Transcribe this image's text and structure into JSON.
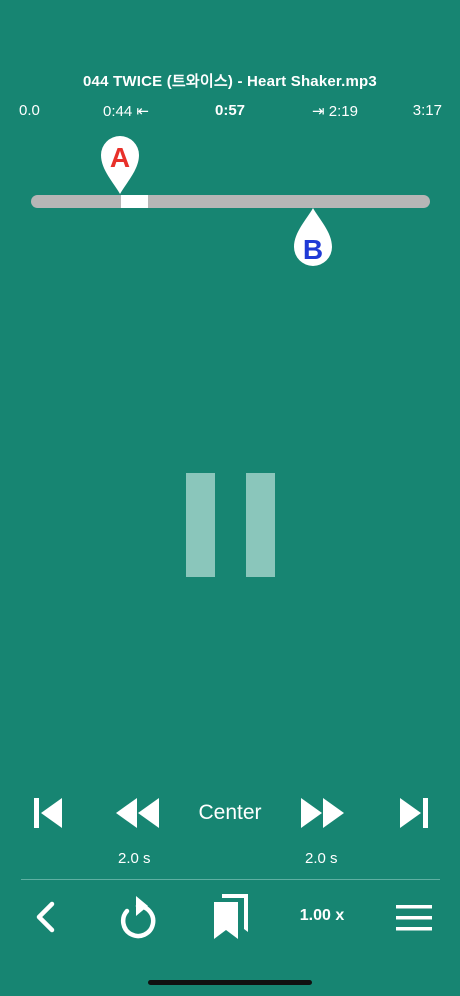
{
  "track": {
    "title": "044 TWICE (트와이스) - Heart Shaker.mp3"
  },
  "times": {
    "start": "0.0",
    "a_point": "0:44 ⇤",
    "current": "0:57",
    "b_point": "⇥ 2:19",
    "end": "3:17"
  },
  "markers": {
    "a_label": "A",
    "b_label": "B",
    "a_color": "#e8302a",
    "b_color": "#1f3ad6"
  },
  "controls": {
    "center_label": "Center",
    "rewind_step": "2.0 s",
    "forward_step": "2.0 s",
    "speed": "1.00 x"
  },
  "icons": {
    "prev": "skip-previous-icon",
    "rewind": "rewind-icon",
    "forward": "fast-forward-icon",
    "next": "skip-next-icon",
    "pause": "pause-icon",
    "back": "chevron-left-icon",
    "replay": "replay-icon",
    "bookmarks": "bookmarks-icon",
    "menu": "hamburger-menu-icon"
  },
  "colors": {
    "background": "#178572",
    "track": "#b6b6b6",
    "pause": "#8ac6bb"
  }
}
